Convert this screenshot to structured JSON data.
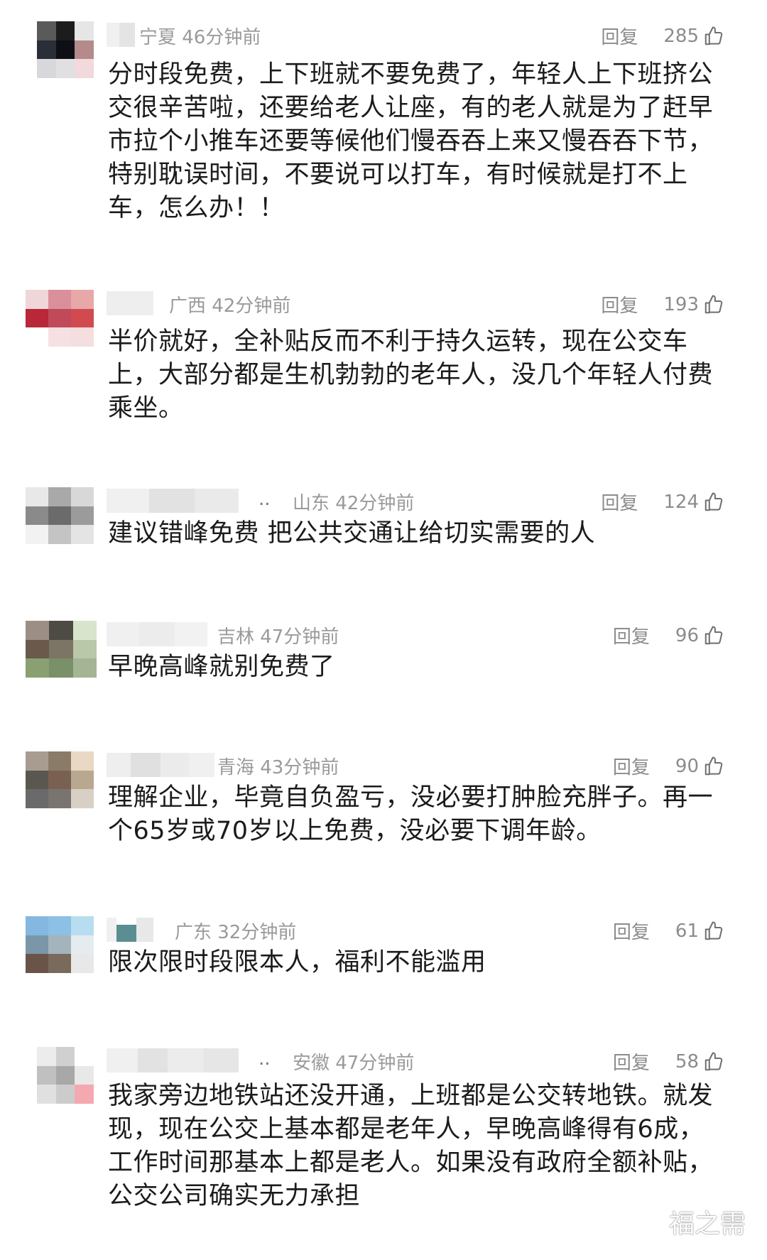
{
  "reply_label": "回复",
  "comments": [
    {
      "region_time": "宁夏 46分钟前",
      "likes": "285",
      "text": "分时段免费，上下班就不要免费了，年轻人上下班挤公交很辛苦啦，还要给老人让座，有的老人就是为了赶早市拉个小推车还要等候他们慢吞吞上来又慢吞吞下节，特别耽误时间，不要说可以打车，有时候就是打不上车，怎么办！！"
    },
    {
      "region_time": "广西 42分钟前",
      "likes": "193",
      "text": "半价就好，全补贴反而不利于持久运转，现在公交车上，大部分都是生机勃勃的老年人，没几个年轻人付费乘坐。"
    },
    {
      "region_time": "山东 42分钟前",
      "likes": "124",
      "ellipsis": "..",
      "text": "建议错峰免费 把公共交通让给切实需要的人"
    },
    {
      "region_time": "吉林 47分钟前",
      "likes": "96",
      "text": "早晚高峰就别免费了"
    },
    {
      "region_time": "青海 43分钟前",
      "likes": "90",
      "text": "理解企业，毕竟自负盈亏，没必要打肿脸充胖子。再一个65岁或70岁以上免费，没必要下调年龄。"
    },
    {
      "region_time": "广东 32分钟前",
      "likes": "61",
      "text": "限次限时段限本人，福利不能滥用"
    },
    {
      "region_time": "安徽 47分钟前",
      "likes": "58",
      "ellipsis": "..",
      "text": "我家旁边地铁站还没开通，上班都是公交转地铁。就发现，现在公交上基本都是老年人，早晚高峰得有6成，工作时间那基本上都是老人。如果没有政府全额补贴，公交公司确实无力承担"
    }
  ],
  "watermark": "福之需"
}
